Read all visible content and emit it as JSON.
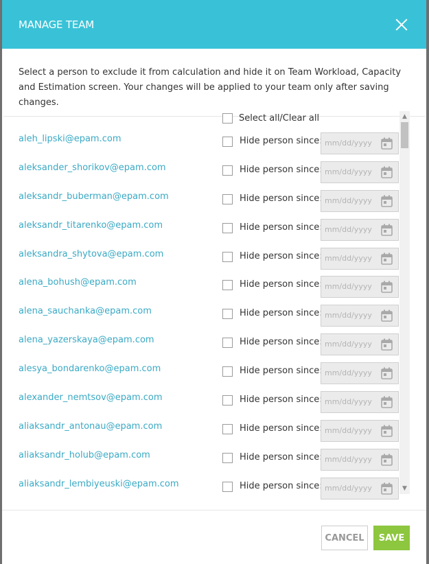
{
  "modal": {
    "title": "MANAGE TEAM",
    "description": "Select a person to exclude it from calculation and hide it on Team Workload, Capacity and Estimation screen. Your changes will be applied to your team only after saving changes.",
    "select_all_label": "Select all/Clear all",
    "hide_label": "Hide person since:",
    "date_placeholder": "mm/dd/yyyy",
    "people": [
      {
        "email": "aleh_lipski@epam.com",
        "checked": false
      },
      {
        "email": "aleksander_shorikov@epam.com",
        "checked": false
      },
      {
        "email": "aleksandr_buberman@epam.com",
        "checked": false
      },
      {
        "email": "aleksandr_titarenko@epam.com",
        "checked": false
      },
      {
        "email": "aleksandra_shytova@epam.com",
        "checked": false
      },
      {
        "email": "alena_bohush@epam.com",
        "checked": false
      },
      {
        "email": "alena_sauchanka@epam.com",
        "checked": false
      },
      {
        "email": "alena_yazerskaya@epam.com",
        "checked": false
      },
      {
        "email": "alesya_bondarenko@epam.com",
        "checked": false
      },
      {
        "email": "alexander_nemtsov@epam.com",
        "checked": false
      },
      {
        "email": "aliaksandr_antonau@epam.com",
        "checked": false
      },
      {
        "email": "aliaksandr_holub@epam.com",
        "checked": false
      },
      {
        "email": "aliaksandr_lembiyeuski@epam.com",
        "checked": false
      }
    ],
    "cancel_label": "CANCEL",
    "save_label": "SAVE"
  },
  "colors": {
    "header": "#39c2d7",
    "link": "#39a9c4",
    "save": "#8dc63f"
  },
  "icons": {
    "close": "close-icon",
    "calendar": "calendar-icon"
  }
}
